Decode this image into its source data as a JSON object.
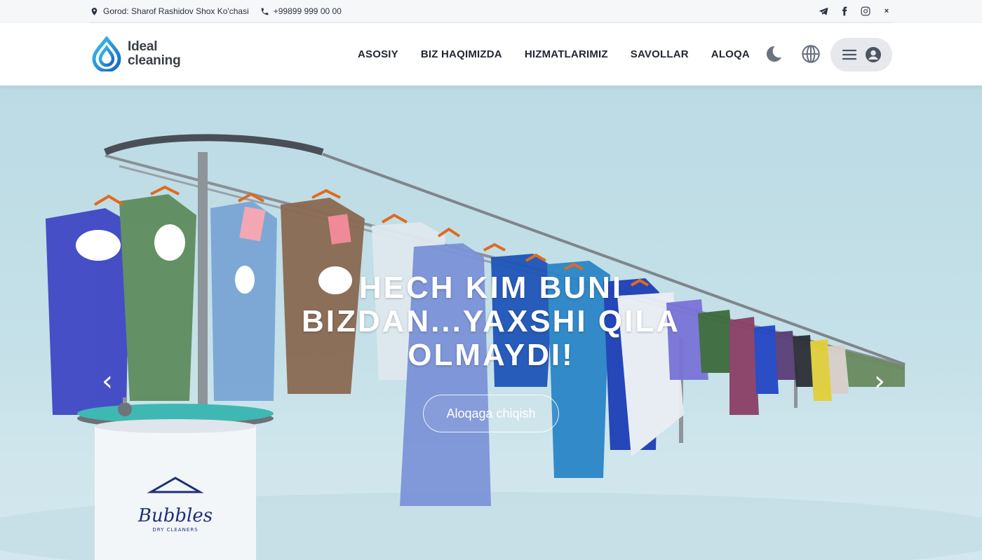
{
  "topbar": {
    "address": "Gorod: Sharof Rashidov Shox Ko'chasi",
    "phone": "+99899 999 00 00",
    "social_icons": [
      "telegram-icon",
      "facebook-icon",
      "instagram-icon",
      "x-icon"
    ],
    "x_label": "×"
  },
  "header": {
    "logo_line1": "Ideal",
    "logo_line2": "cleaning",
    "nav": [
      "ASOSIY",
      "BIZ HAQIMIZDA",
      "HIZMATLARIMIZ",
      "SAVOLLAR",
      "ALOQA"
    ],
    "icons": [
      "moon-icon",
      "globe-icon",
      "menu-icon",
      "user-icon"
    ]
  },
  "hero": {
    "title": "HECH KIM BUNI BIZDAN...YAXSHI QILA OLMAYDI!",
    "button_label": "Aloqaga chiqish",
    "prev_arrow": "‹",
    "next_arrow": "›",
    "brand_on_image": "Bubbles",
    "brand_sub_on_image": "DRY CLEANERS"
  },
  "colors": {
    "accent": "#1e88d6",
    "hero_bg": "#c5e0e8",
    "nav_text": "#222832"
  }
}
